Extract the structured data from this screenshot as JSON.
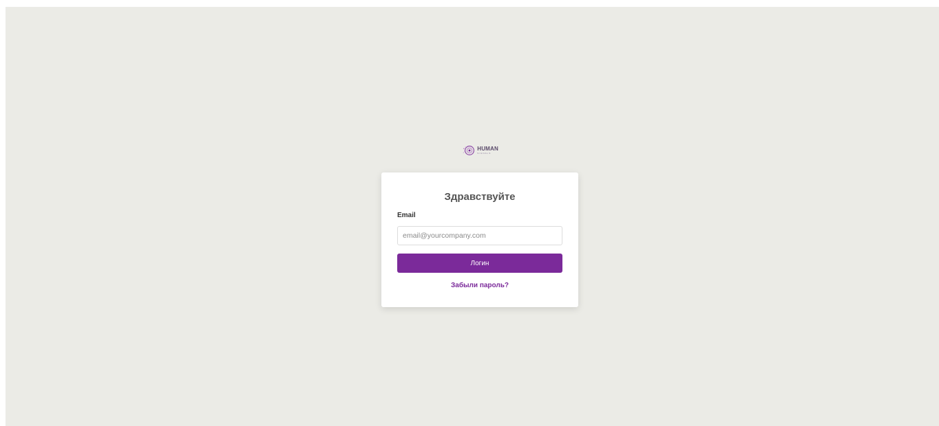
{
  "brand": {
    "logo_icon": "human-signals-logo",
    "name": "HUMAN",
    "tagline": "SIGNALS",
    "accent_color": "#7b2a9a"
  },
  "login": {
    "title": "Здравствуйте",
    "email_label": "Email",
    "email_placeholder": "email@yourcompany.com",
    "email_value": "",
    "submit_label": "Логин",
    "forgot_label": "Забыли пароль?"
  },
  "colors": {
    "background": "#ebebe6",
    "card": "#ffffff",
    "button": "#7b2a9a",
    "link": "#7b2a9a"
  }
}
